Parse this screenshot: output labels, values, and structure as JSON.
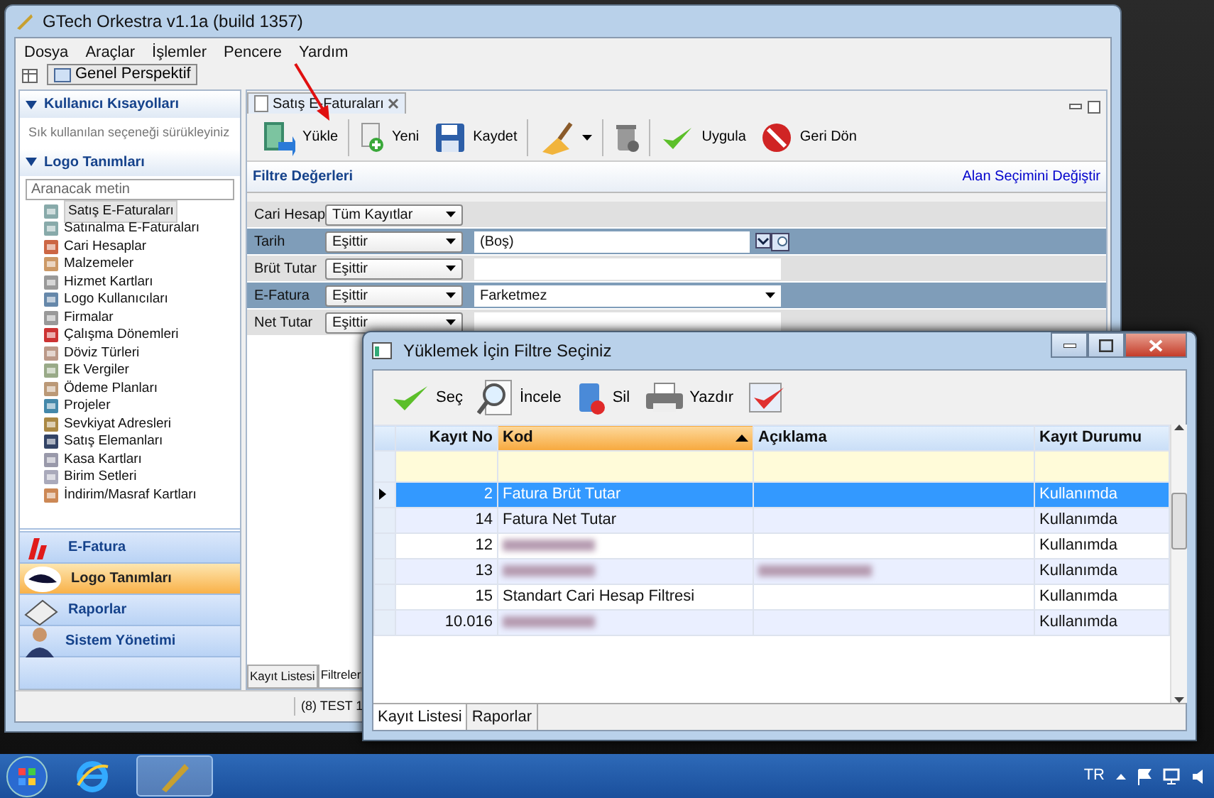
{
  "main_window": {
    "title": "GTech Orkestra v1.1a (build 1357)"
  },
  "menu": [
    "Dosya",
    "Araçlar",
    "İşlemler",
    "Pencere",
    "Yardım"
  ],
  "perspective": {
    "label": "Genel Perspektif"
  },
  "sidebar": {
    "shortcuts": {
      "title": "Kullanıcı Kısayolları",
      "expanded": true,
      "hint": "Sık kullanılan seçeneği sürükleyiniz"
    },
    "definitions": {
      "title": "Logo Tanımları",
      "expanded": true,
      "search_placeholder": "Aranacak metin",
      "items": [
        {
          "label": "Satış E-Faturaları",
          "selected": true
        },
        {
          "label": "Satınalma E-Faturaları",
          "selected": false
        },
        {
          "label": "Cari Hesaplar",
          "selected": false
        },
        {
          "label": "Malzemeler",
          "selected": false
        },
        {
          "label": "Hizmet Kartları",
          "selected": false
        },
        {
          "label": "Logo Kullanıcıları",
          "selected": false
        },
        {
          "label": "Firmalar",
          "selected": false
        },
        {
          "label": "Çalışma Dönemleri",
          "selected": false
        },
        {
          "label": "Döviz Türleri",
          "selected": false
        },
        {
          "label": "Ek Vergiler",
          "selected": false
        },
        {
          "label": "Ödeme Planları",
          "selected": false
        },
        {
          "label": "Projeler",
          "selected": false
        },
        {
          "label": "Sevkiyat Adresleri",
          "selected": false
        },
        {
          "label": "Satış Elemanları",
          "selected": false
        },
        {
          "label": "Kasa Kartları",
          "selected": false
        },
        {
          "label": "Birim Setleri",
          "selected": false
        },
        {
          "label": "İndirim/Masraf Kartları",
          "selected": false
        }
      ]
    },
    "nav": [
      {
        "label": "E-Fatura",
        "kind": "efatura",
        "selected": false
      },
      {
        "label": "Logo Tanımları",
        "kind": "logo",
        "selected": true
      },
      {
        "label": "Raporlar",
        "kind": "reports",
        "selected": false
      },
      {
        "label": "Sistem Yönetimi",
        "kind": "admin",
        "selected": false
      }
    ]
  },
  "editor": {
    "tab": "Satış E-Faturaları",
    "toolbar": [
      {
        "kind": "load",
        "label": "Yükle"
      },
      {
        "kind": "new",
        "label": "Yeni"
      },
      {
        "kind": "save",
        "label": "Kaydet"
      },
      {
        "kind": "broom"
      },
      {
        "kind": "trash"
      },
      {
        "kind": "apply",
        "label": "Uygula"
      },
      {
        "kind": "revert",
        "label": "Geri Dön"
      }
    ],
    "annotation": {
      "kind": "arrow"
    },
    "filter_title": "Filtre Değerleri",
    "field_link": "Alan Seçimini Değiştir",
    "filters": [
      {
        "label": "Cari Hesap",
        "operator": "Tüm Kayıtlar",
        "highlighted": false
      },
      {
        "label": "Tarih",
        "operator": "Eşittir",
        "value": "(Boş)",
        "kind": "date",
        "highlighted": true
      },
      {
        "label": "Brüt Tutar",
        "operator": "Eşittir",
        "kind": "text",
        "highlighted": false
      },
      {
        "label": "E-Fatura",
        "operator": "Eşittir",
        "value": "Farketmez",
        "kind": "select",
        "highlighted": true
      },
      {
        "label": "Net Tutar",
        "operator": "Eşittir",
        "kind": "text",
        "highlighted": false
      }
    ],
    "bottom_tabs": [
      {
        "label": "Kayıt Listesi",
        "selected": false
      },
      {
        "label": "Filtreler",
        "selected": true
      }
    ]
  },
  "status_bar": "(8) TEST 1",
  "dialog": {
    "title": "Yüklemek İçin Filtre Seçiniz",
    "toolbar": [
      {
        "kind": "select",
        "label": "Seç"
      },
      {
        "kind": "inspect",
        "label": "İncele"
      },
      {
        "kind": "delete",
        "label": "Sil"
      },
      {
        "kind": "print",
        "label": "Yazdır"
      },
      {
        "kind": "approve"
      }
    ],
    "columns": [
      {
        "label": "Kayıt No",
        "sorted": false
      },
      {
        "label": "Kod",
        "sorted": true
      },
      {
        "label": "Açıklama",
        "sorted": false
      },
      {
        "label": "Kayıt Durumu",
        "sorted": false
      }
    ],
    "rows": [
      {
        "no": "2",
        "kod": "Fatura Brüt Tutar",
        "durum": "Kullanımda",
        "selected": true
      },
      {
        "no": "14",
        "kod": "Fatura Net Tutar",
        "durum": "Kullanımda",
        "selected": false
      },
      {
        "no": "12",
        "kod_blurred": true,
        "durum": "Kullanımda",
        "selected": false
      },
      {
        "no": "13",
        "kod_blurred": true,
        "aciklama_blurred": true,
        "durum": "Kullanımda",
        "selected": false
      },
      {
        "no": "15",
        "kod": "Standart Cari Hesap Filtresi",
        "durum": "Kullanımda",
        "selected": false
      },
      {
        "no": "10.016",
        "kod_blurred": true,
        "durum": "Kullanımda",
        "selected": false
      }
    ],
    "tabs": [
      {
        "label": "Kayıt Listesi",
        "selected": true
      },
      {
        "label": "Raporlar",
        "selected": false
      }
    ]
  },
  "taskbar": {
    "apps": [
      {
        "kind": "browser",
        "active": false
      },
      {
        "kind": "orkestra",
        "active": true
      }
    ],
    "language": "TR"
  }
}
